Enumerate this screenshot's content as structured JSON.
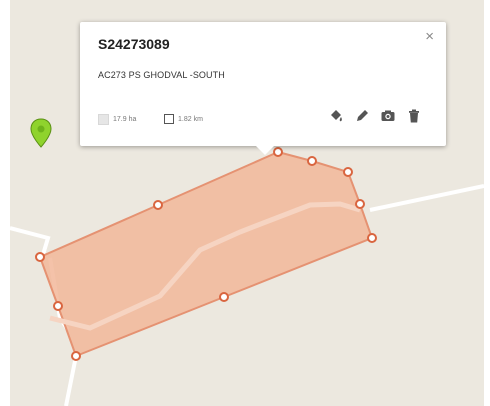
{
  "popup": {
    "title": "S24273089",
    "description": "AC273 PS GHODVAL -SOUTH",
    "close_label": "×",
    "area": "17.9 ha",
    "perimeter": "1.82 km"
  },
  "icons": {
    "close": "close-icon",
    "area": "area-square-icon",
    "perimeter": "perimeter-square-icon",
    "fill": "paint-bucket-icon",
    "edit": "pencil-icon",
    "camera": "camera-icon",
    "delete": "trash-icon",
    "marker": "location-pin-icon"
  },
  "colors": {
    "map_background": "#ece8df",
    "road": "#ffffff",
    "polygon_fill": "#f2b79a",
    "polygon_stroke": "#e59272",
    "vertex_stroke": "#d9653f",
    "marker": "#8fd32d"
  }
}
